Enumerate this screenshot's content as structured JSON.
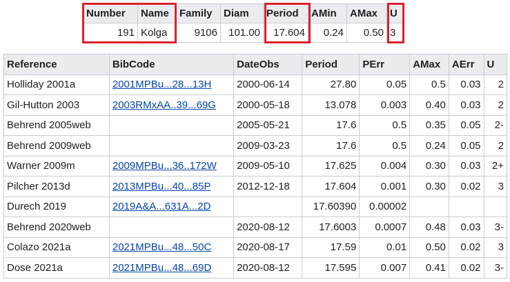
{
  "summary": {
    "headers": [
      "Number",
      "Name",
      "Family",
      "Diam",
      "Period",
      "AMin",
      "AMax",
      "U"
    ],
    "values": [
      "191",
      "Kolga",
      "9106",
      "101.00",
      "17.604",
      "0.24",
      "0.50",
      "3"
    ]
  },
  "references": {
    "headers": [
      "Reference",
      "BibCode",
      "DateObs",
      "Period",
      "PErr",
      "AMax",
      "AErr",
      "U"
    ],
    "rows": [
      {
        "reference": "Holliday 2001a",
        "bibcode": "2001MPBu...28...13H",
        "dateobs": "2000-06-14",
        "period": "27.80",
        "perr": "0.05",
        "amax": "0.5",
        "aerr": "0.03",
        "u": "2"
      },
      {
        "reference": "Gil-Hutton 2003",
        "bibcode": "2003RMxAA..39...69G",
        "dateobs": "2000-05-18",
        "period": "13.078",
        "perr": "0.003",
        "amax": "0.40",
        "aerr": "0.03",
        "u": "2"
      },
      {
        "reference": "Behrend 2005web",
        "bibcode": "",
        "dateobs": "2005-05-21",
        "period": "17.6",
        "perr": "0.5",
        "amax": "0.35",
        "aerr": "0.05",
        "u": "2-"
      },
      {
        "reference": "Behrend 2009web",
        "bibcode": "",
        "dateobs": "2009-03-23",
        "period": "17.6",
        "perr": "0.5",
        "amax": "0.24",
        "aerr": "0.05",
        "u": "2"
      },
      {
        "reference": "Warner 2009m",
        "bibcode": "2009MPBu...36..172W",
        "dateobs": "2009-05-10",
        "period": "17.625",
        "perr": "0.004",
        "amax": "0.30",
        "aerr": "0.03",
        "u": "2+"
      },
      {
        "reference": "Pilcher 2013d",
        "bibcode": "2013MPBu...40...85P",
        "dateobs": "2012-12-18",
        "period": "17.604",
        "perr": "0.001",
        "amax": "0.30",
        "aerr": "0.02",
        "u": "3"
      },
      {
        "reference": "Durech 2019",
        "bibcode": "2019A&A...631A...2D",
        "dateobs": "",
        "period": "17.60390",
        "perr": "0.00002",
        "amax": "",
        "aerr": "",
        "u": ""
      },
      {
        "reference": "Behrend 2020web",
        "bibcode": "",
        "dateobs": "2020-08-12",
        "period": "17.6003",
        "perr": "0.0007",
        "amax": "0.48",
        "aerr": "0.03",
        "u": "3-"
      },
      {
        "reference": "Colazo 2021a",
        "bibcode": "2021MPBu...48...50C",
        "dateobs": "2020-08-17",
        "period": "17.59",
        "perr": "0.01",
        "amax": "0.50",
        "aerr": "0.02",
        "u": "3"
      },
      {
        "reference": "Dose 2021a",
        "bibcode": "2021MPBu...48...69D",
        "dateobs": "2020-08-12",
        "period": "17.595",
        "perr": "0.007",
        "amax": "0.41",
        "aerr": "0.02",
        "u": "3-"
      }
    ]
  },
  "colors": {
    "highlight": "#d9232e",
    "link": "#0645ad",
    "header_bg": "#eaecf0",
    "border": "#c8ccd1"
  }
}
